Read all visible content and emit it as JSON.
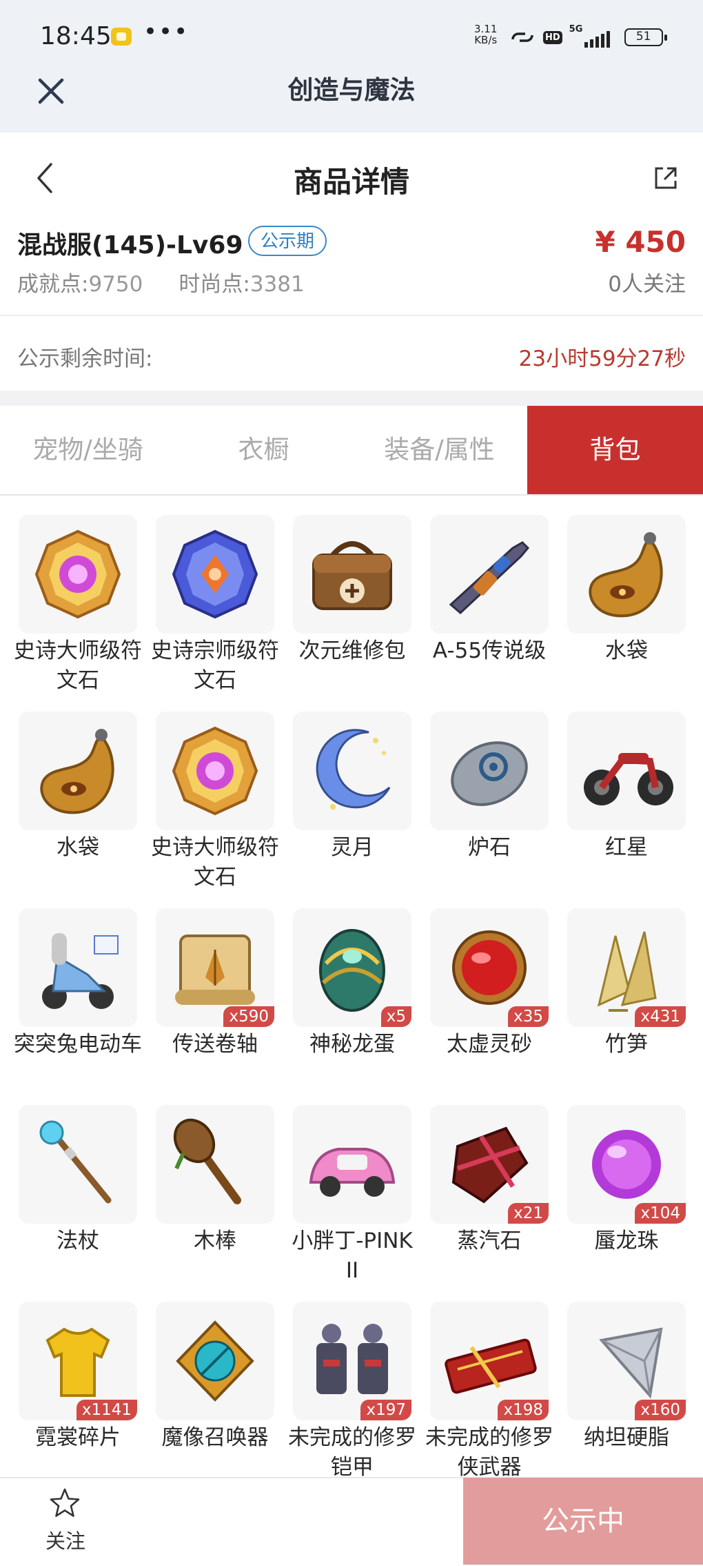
{
  "status_bar": {
    "time": "18:45",
    "dots": "•••",
    "speed_value": "3.11",
    "speed_unit": "KB/s",
    "hd": "HD",
    "network": "5G",
    "battery": "51"
  },
  "app": {
    "title": "创造与魔法"
  },
  "nav": {
    "title": "商品详情"
  },
  "product": {
    "name": "混战服(145)-Lv69",
    "badge": "公示期",
    "price": "¥ 450",
    "achievement_label": "成就点:",
    "achievement_value": "9750",
    "fashion_label": "时尚点:",
    "fashion_value": "3381",
    "followers": "0人关注"
  },
  "timer": {
    "label": "公示剩余时间:",
    "value": "23小时59分27秒"
  },
  "tabs": [
    {
      "label": "宠物/坐骑",
      "active": false
    },
    {
      "label": "衣橱",
      "active": false
    },
    {
      "label": "装备/属性",
      "active": false
    },
    {
      "label": "背包",
      "active": true
    }
  ],
  "items": [
    {
      "name": "史诗大师级符文石",
      "icon": "rune-stone-gold-icon",
      "qty": ""
    },
    {
      "name": "史诗宗师级符文石",
      "icon": "rune-stone-blue-icon",
      "qty": ""
    },
    {
      "name": "次元维修包",
      "icon": "repair-bag-icon",
      "qty": ""
    },
    {
      "name": "A-55传说级",
      "icon": "rifle-icon",
      "qty": ""
    },
    {
      "name": "水袋",
      "icon": "water-bag-icon",
      "qty": ""
    },
    {
      "name": "水袋",
      "icon": "water-bag-icon",
      "qty": ""
    },
    {
      "name": "史诗大师级符文石",
      "icon": "rune-stone-gold-icon",
      "qty": ""
    },
    {
      "name": "灵月",
      "icon": "crescent-moon-icon",
      "qty": ""
    },
    {
      "name": "炉石",
      "icon": "hearthstone-icon",
      "qty": ""
    },
    {
      "name": "红星",
      "icon": "motorcycle-icon",
      "qty": ""
    },
    {
      "name": "突突兔电动车",
      "icon": "scooter-icon",
      "qty": ""
    },
    {
      "name": "传送卷轴",
      "icon": "scroll-icon",
      "qty": "x590"
    },
    {
      "name": "神秘龙蛋",
      "icon": "dragon-egg-icon",
      "qty": "x5"
    },
    {
      "name": "太虚灵砂",
      "icon": "red-gem-icon",
      "qty": "x35"
    },
    {
      "name": "竹笋",
      "icon": "bamboo-shoot-icon",
      "qty": "x431"
    },
    {
      "name": "法杖",
      "icon": "staff-icon",
      "qty": ""
    },
    {
      "name": "木棒",
      "icon": "club-icon",
      "qty": ""
    },
    {
      "name": "小胖丁-PINK II",
      "icon": "pink-car-icon",
      "qty": ""
    },
    {
      "name": "蒸汽石",
      "icon": "steam-stone-icon",
      "qty": "x21"
    },
    {
      "name": "蜃龙珠",
      "icon": "purple-orb-icon",
      "qty": "x104"
    },
    {
      "name": "霓裳碎片",
      "icon": "shirt-fragment-icon",
      "qty": "x1141"
    },
    {
      "name": "魔像召唤器",
      "icon": "golem-summoner-icon",
      "qty": ""
    },
    {
      "name": "未完成的修罗铠甲",
      "icon": "armor-icon",
      "qty": "x197"
    },
    {
      "name": "未完成的修罗侠武器",
      "icon": "weapon-box-icon",
      "qty": "x198"
    },
    {
      "name": "纳坦硬脂",
      "icon": "prism-icon",
      "qty": "x160"
    }
  ],
  "bottom": {
    "follow_label": "关注",
    "cta_label": "公示中"
  },
  "colors": {
    "accent": "#c8302e",
    "price": "#c9302c",
    "badge": "#2f7fc1",
    "cta_disabled": "#e29c9b"
  }
}
